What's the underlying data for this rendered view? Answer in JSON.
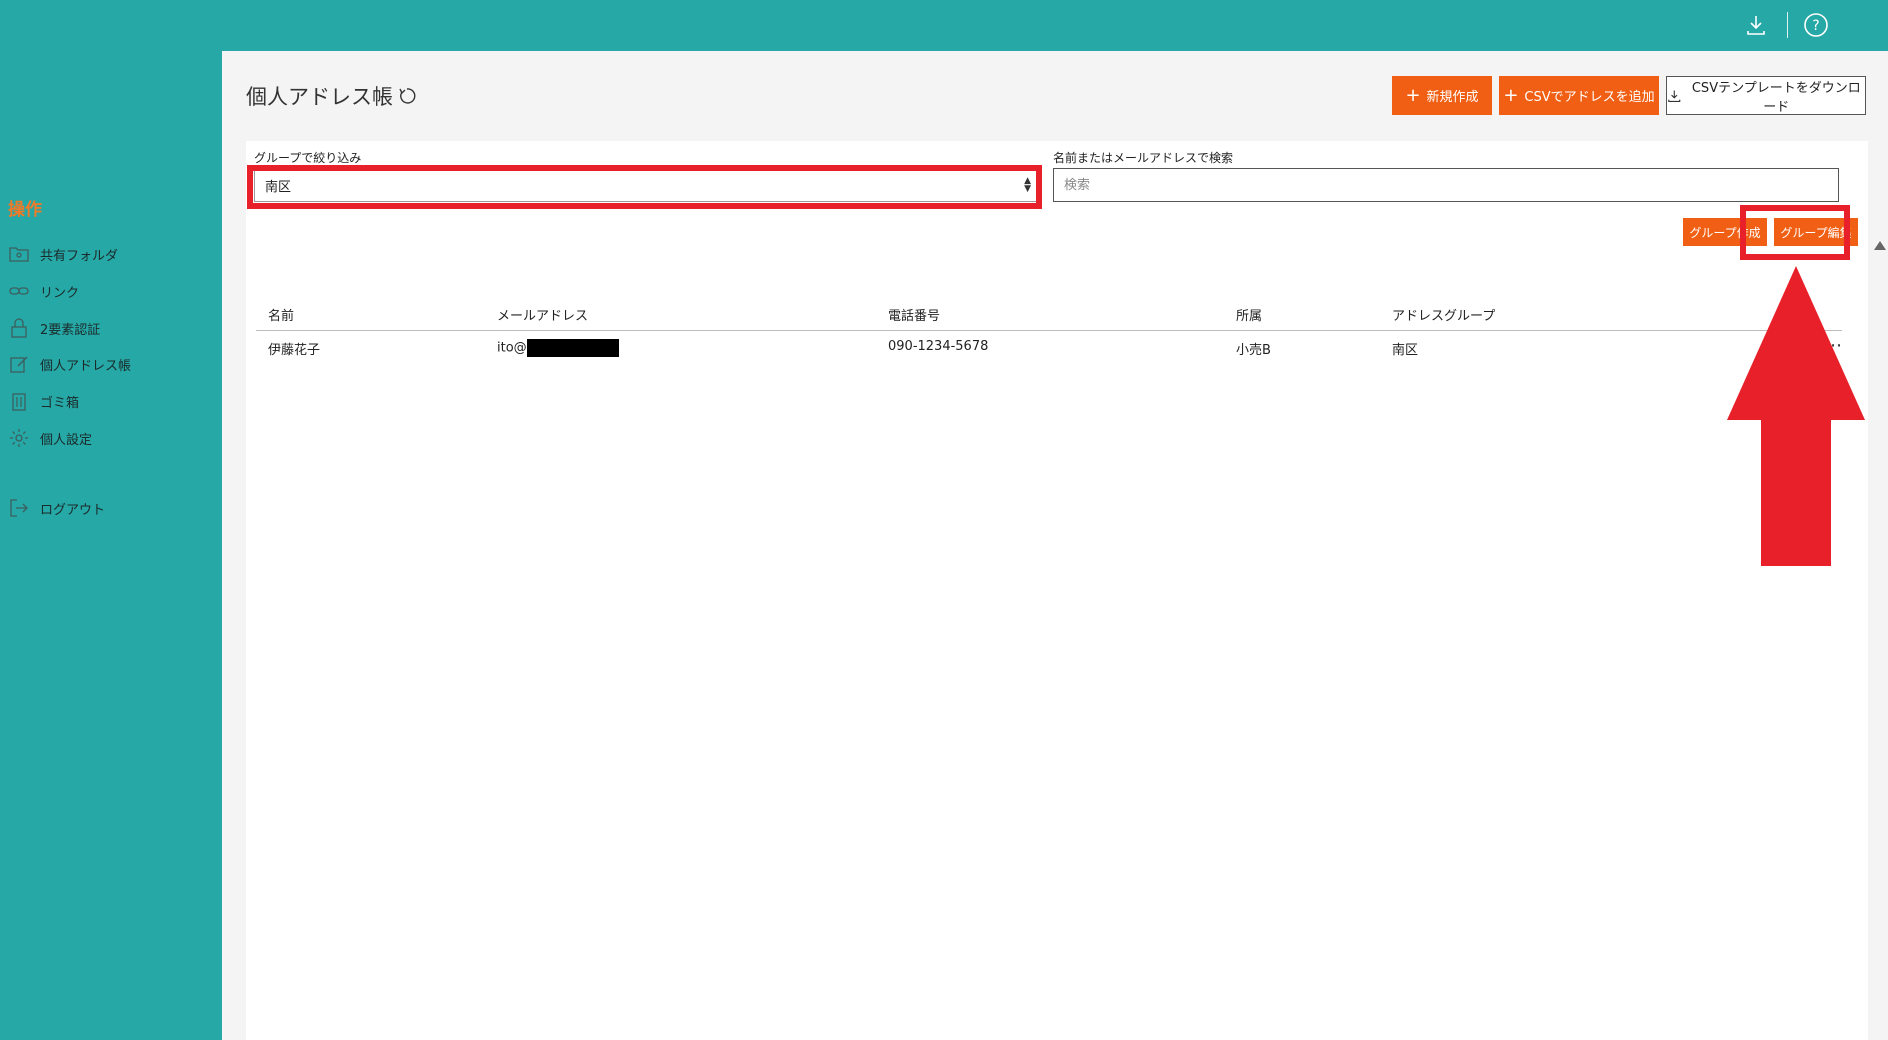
{
  "topbar": {
    "icons": [
      "download-icon",
      "help-icon"
    ]
  },
  "sidebar": {
    "heading": "操作",
    "items": [
      {
        "label": "共有フォルダ",
        "icon": "shared-folder-icon"
      },
      {
        "label": "リンク",
        "icon": "link-icon"
      },
      {
        "label": "2要素認証",
        "icon": "lock-icon"
      },
      {
        "label": "個人アドレス帳",
        "icon": "edit-icon"
      },
      {
        "label": "ゴミ箱",
        "icon": "trash-icon"
      },
      {
        "label": "個人設定",
        "icon": "gear-icon"
      },
      {
        "label": "ログアウト",
        "icon": "logout-icon"
      }
    ]
  },
  "page": {
    "title": "個人アドレス帳",
    "new_button": "新規作成",
    "csv_add_button": "CSVでアドレスを追加",
    "csv_template_button": "CSVテンプレートをダウンロード"
  },
  "filter": {
    "group_label": "グループで絞り込み",
    "group_value": "南区",
    "search_label": "名前またはメールアドレスで検索",
    "search_placeholder": "検索"
  },
  "group_actions": {
    "create": "グループ作成",
    "edit": "グループ編集"
  },
  "table": {
    "headers": [
      "名前",
      "メールアドレス",
      "電話番号",
      "所属",
      "アドレスグループ"
    ],
    "rows": [
      {
        "name": "伊藤花子",
        "email_prefix": "ito@",
        "phone": "090-1234-5678",
        "affiliation": "小売B",
        "group": "南区",
        "menu": "⋯"
      }
    ]
  },
  "colors": {
    "teal": "#26a8a6",
    "orange": "#f05f14",
    "highlight_red": "#e8202a"
  }
}
